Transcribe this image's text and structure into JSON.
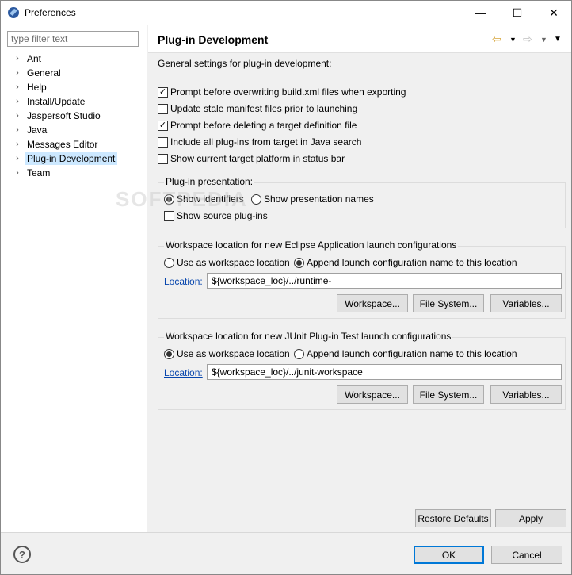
{
  "window": {
    "title": "Preferences",
    "controls": {
      "minimize": "—",
      "maximize": "☐",
      "close": "✕"
    }
  },
  "sidebar": {
    "filter_placeholder": "type filter text",
    "items": [
      {
        "label": "Ant"
      },
      {
        "label": "General"
      },
      {
        "label": "Help"
      },
      {
        "label": "Install/Update"
      },
      {
        "label": "Jaspersoft Studio"
      },
      {
        "label": "Java"
      },
      {
        "label": "Messages Editor"
      },
      {
        "label": "Plug-in Development",
        "selected": true
      },
      {
        "label": "Team"
      }
    ]
  },
  "page": {
    "title": "Plug-in Development",
    "description": "General settings for plug-in development:",
    "options": [
      {
        "label": "Prompt before overwriting build.xml files when exporting",
        "checked": true
      },
      {
        "label": "Update stale manifest files prior to launching",
        "checked": false
      },
      {
        "label": "Prompt before deleting a target definition file",
        "checked": true
      },
      {
        "label": "Include all plug-ins from target in Java search",
        "checked": false
      },
      {
        "label": "Show current target platform in status bar",
        "checked": false
      }
    ],
    "presentation": {
      "title": "Plug-in presentation:",
      "show_identifiers": "Show identifiers",
      "show_presentation_names": "Show presentation names",
      "show_source": "Show source plug-ins",
      "selected": "identifiers"
    },
    "eclipse_app": {
      "title": "Workspace location for new Eclipse Application launch configurations",
      "use_as": "Use as workspace location",
      "append": "Append launch configuration name to this location",
      "selected": "append",
      "location_label": "Location:",
      "location_value": "${workspace_loc}/../runtime-",
      "btn_workspace": "Workspace...",
      "btn_filesystem": "File System...",
      "btn_variables": "Variables..."
    },
    "junit": {
      "title": "Workspace location for new JUnit Plug-in Test launch configurations",
      "use_as": "Use as workspace location",
      "append": "Append launch configuration name to this location",
      "selected": "use_as",
      "location_label": "Location:",
      "location_value": "${workspace_loc}/../junit-workspace",
      "btn_workspace": "Workspace...",
      "btn_filesystem": "File System...",
      "btn_variables": "Variables..."
    },
    "restore_defaults": "Restore Defaults",
    "apply": "Apply"
  },
  "footer": {
    "help": "?",
    "ok": "OK",
    "cancel": "Cancel"
  },
  "watermark": "SOFTPEDIA"
}
